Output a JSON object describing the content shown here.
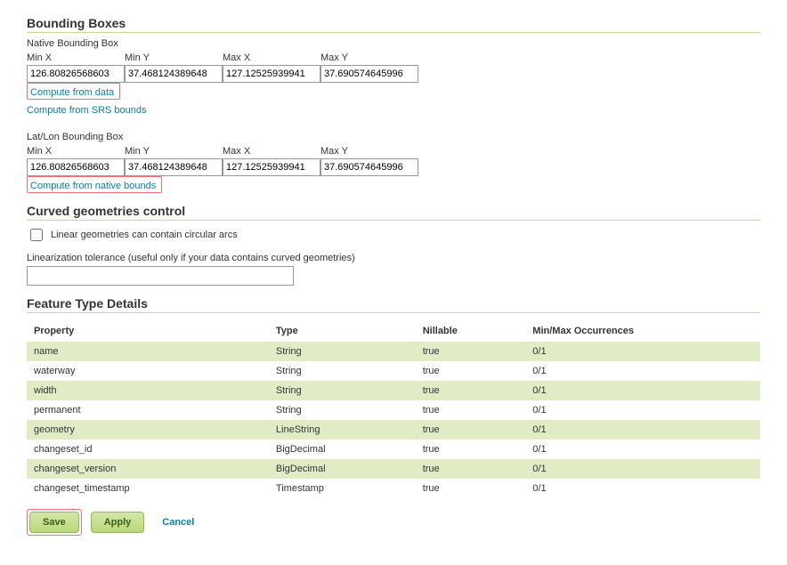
{
  "sections": {
    "bboxes_title": "Bounding Boxes",
    "native_bbox_label": "Native Bounding Box",
    "latlon_bbox_label": "Lat/Lon Bounding Box",
    "curved_title": "Curved geometries control",
    "curved_checkbox_label": "Linear geometries can contain circular arcs",
    "tolerance_label": "Linearization tolerance (useful only if your data contains curved geometries)",
    "feature_title": "Feature Type Details"
  },
  "bbox_cols": {
    "minx": "Min X",
    "miny": "Min Y",
    "maxx": "Max X",
    "maxy": "Max Y"
  },
  "native_bbox": {
    "minx": "126.80826568603",
    "miny": "37.468124389648",
    "maxx": "127.12525939941",
    "maxy": "37.690574645996"
  },
  "latlon_bbox": {
    "minx": "126.80826568603",
    "miny": "37.468124389648",
    "maxx": "127.12525939941",
    "maxy": "37.690574645996"
  },
  "links": {
    "compute_from_data": "Compute from data",
    "compute_from_srs": "Compute from SRS bounds",
    "compute_from_native": "Compute from native bounds"
  },
  "tolerance_value": "",
  "feature_headers": {
    "property": "Property",
    "type": "Type",
    "nillable": "Nillable",
    "occur": "Min/Max Occurrences"
  },
  "features": [
    {
      "p": "name",
      "t": "String",
      "n": "true",
      "o": "0/1"
    },
    {
      "p": "waterway",
      "t": "String",
      "n": "true",
      "o": "0/1"
    },
    {
      "p": "width",
      "t": "String",
      "n": "true",
      "o": "0/1"
    },
    {
      "p": "permanent",
      "t": "String",
      "n": "true",
      "o": "0/1"
    },
    {
      "p": "geometry",
      "t": "LineString",
      "n": "true",
      "o": "0/1"
    },
    {
      "p": "changeset_id",
      "t": "BigDecimal",
      "n": "true",
      "o": "0/1"
    },
    {
      "p": "changeset_version",
      "t": "BigDecimal",
      "n": "true",
      "o": "0/1"
    },
    {
      "p": "changeset_timestamp",
      "t": "Timestamp",
      "n": "true",
      "o": "0/1"
    }
  ],
  "footer": {
    "save": "Save",
    "apply": "Apply",
    "cancel": "Cancel"
  }
}
